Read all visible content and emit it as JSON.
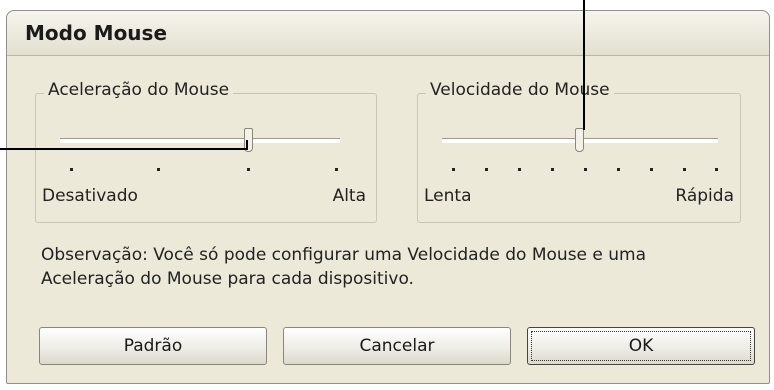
{
  "dialog": {
    "title": "Modo Mouse"
  },
  "acceleration": {
    "legend": "Aceleração do Mouse",
    "min_label": "Desativado",
    "max_label": "Alta",
    "positions": 4,
    "selected_index": 2
  },
  "speed": {
    "legend": "Velocidade do Mouse",
    "min_label": "Lenta",
    "max_label": "Rápida",
    "positions": 9,
    "selected_index": 4
  },
  "note": "Observação: Você só pode configurar uma Velocidade do Mouse e uma Aceleração do Mouse para cada dispositivo.",
  "buttons": {
    "default_label": "Padrão",
    "cancel_label": "Cancelar",
    "ok_label": "OK"
  }
}
